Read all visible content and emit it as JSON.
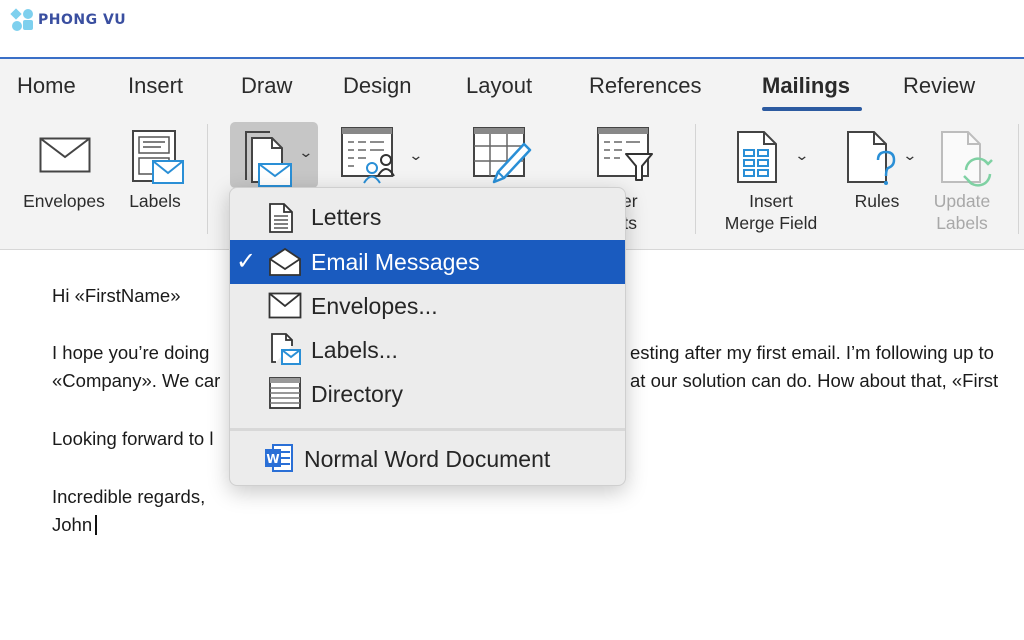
{
  "watermark": {
    "text": "PHONG VU"
  },
  "ribbon": {
    "tabs": [
      {
        "label": "Home"
      },
      {
        "label": "Insert"
      },
      {
        "label": "Draw"
      },
      {
        "label": "Design"
      },
      {
        "label": "Layout"
      },
      {
        "label": "References"
      },
      {
        "label": "Mailings",
        "active": true
      },
      {
        "label": "Review"
      }
    ],
    "buttons": {
      "envelopes": {
        "label": "Envelopes",
        "icon": "envelope-icon"
      },
      "labels": {
        "label": "Labels",
        "icon": "labels-icon"
      },
      "start_mail_merge": {
        "label": "",
        "icon": "start-mail-merge-icon"
      },
      "select_recipients": {
        "label": "",
        "icon": "select-recipients-icon"
      },
      "edit_recipient_list": {
        "label": "",
        "icon": "edit-recipient-list-icon"
      },
      "filter_recipients": {
        "line1": "er",
        "line2": "ients",
        "icon": "filter-recipients-icon"
      },
      "insert_merge_field": {
        "line1": "Insert",
        "line2": "Merge Field",
        "icon": "insert-merge-field-icon"
      },
      "rules": {
        "label": "Rules",
        "icon": "rules-icon"
      },
      "update_labels": {
        "line1": "Update",
        "line2": "Labels",
        "icon": "update-labels-icon",
        "disabled": true
      }
    }
  },
  "dropdown": {
    "items": [
      {
        "label": "Letters",
        "icon": "letter-icon"
      },
      {
        "label": "Email Messages",
        "icon": "email-open-icon",
        "selected": true
      },
      {
        "label": "Envelopes...",
        "icon": "envelope-icon"
      },
      {
        "label": "Labels...",
        "icon": "labels-icon"
      },
      {
        "label": "Directory",
        "icon": "directory-icon"
      },
      {
        "label": "Normal Word Document",
        "icon": "word-document-icon"
      }
    ],
    "check_glyph": "✓",
    "selected_color": "#1a5bbf"
  },
  "document": {
    "lines": [
      "Hi «FirstName»",
      "I hope you’re doing well. Thanks so much for your interesting after my first email. I’m following up to",
      "«Company». We can help you, and would love to show you what our solution can do. How about that, «FirstName»",
      "Looking forward to hearing from you.",
      "Incredible regards,",
      "John"
    ],
    "visible_lines": [
      {
        "left": "Hi «FirstName»"
      },
      {
        "left": "I hope you’re doing",
        "right": "esting after my first email. I’m following up to"
      },
      {
        "left": "«Company». We car",
        "right": "at our solution can do. How about that, «First"
      },
      {
        "left": "Looking forward to l"
      },
      {
        "left": "Incredible regards,"
      },
      {
        "left": "John"
      }
    ]
  },
  "colors": {
    "accent": "#2c5aa0",
    "ribbon_bg": "#f3f3f3",
    "icon_blue": "#2a8fd6",
    "icon_green": "#7fd1a3",
    "menu_selected": "#1a5bbf"
  }
}
